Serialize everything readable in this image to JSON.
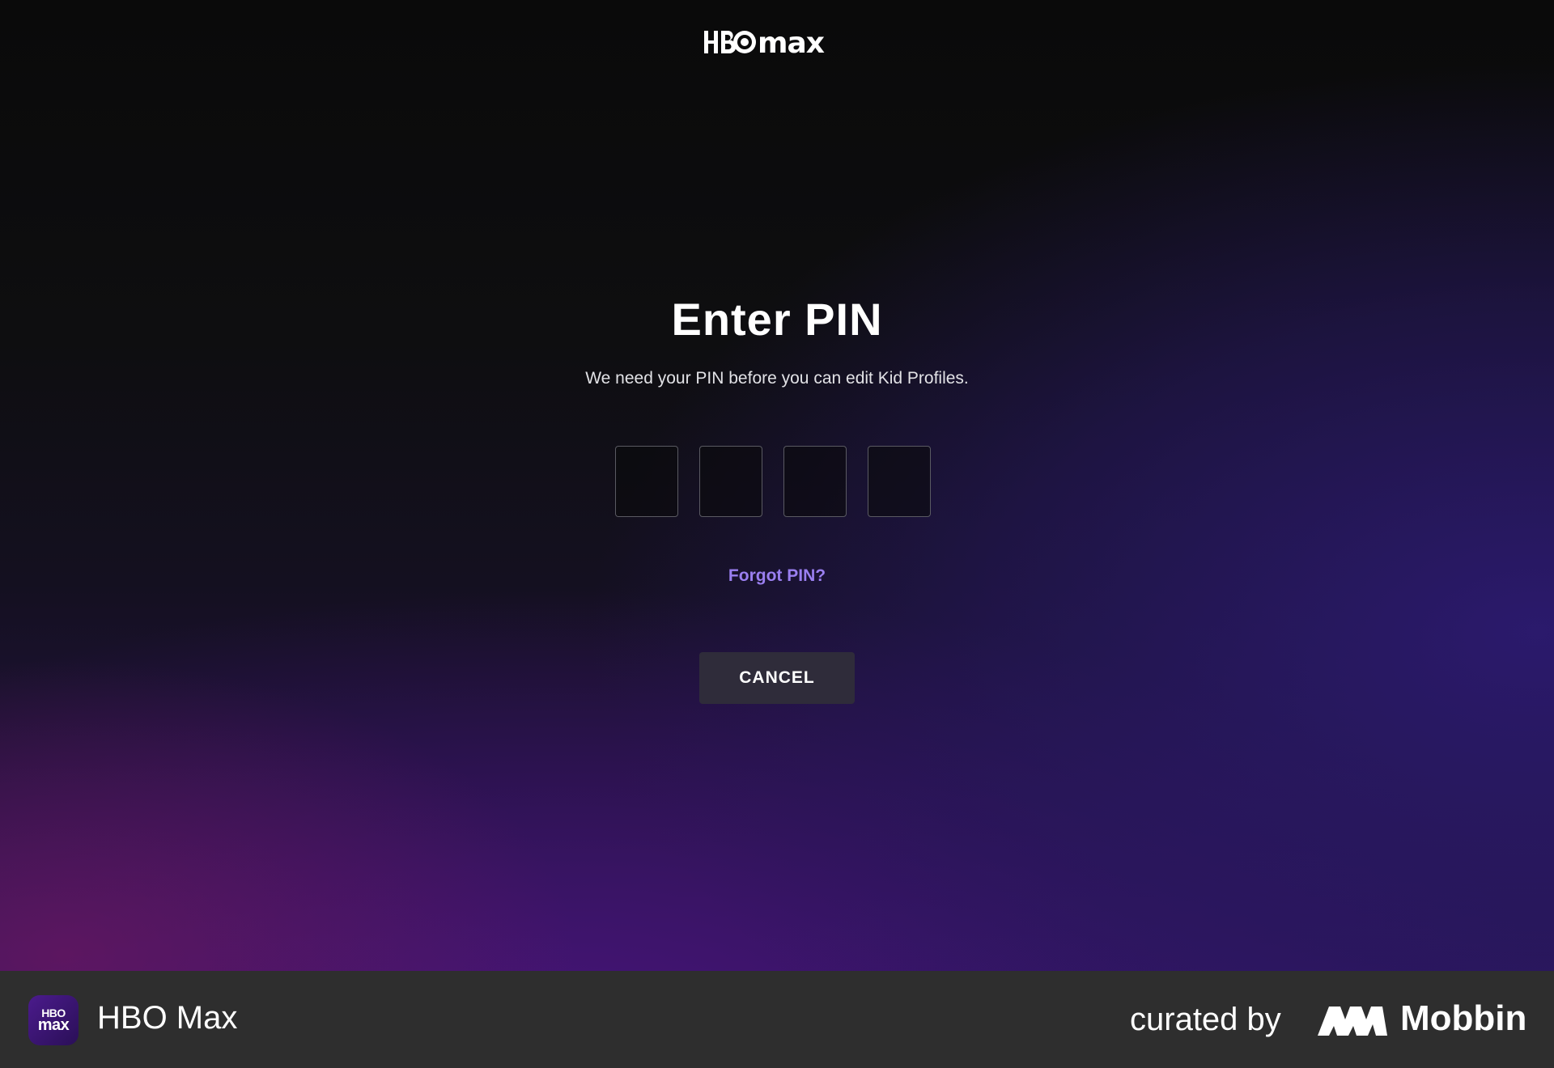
{
  "header": {
    "logo_icon": "hbo-max-logo",
    "logo_text": "HBOmax"
  },
  "main": {
    "title": "Enter PIN",
    "subtitle": "We need your PIN before you can edit Kid Profiles.",
    "pin_fields": [
      {
        "value": ""
      },
      {
        "value": ""
      },
      {
        "value": ""
      },
      {
        "value": ""
      }
    ],
    "forgot_link": "Forgot PIN?",
    "cancel_label": "CANCEL",
    "colors": {
      "accent": "#9a7ff0",
      "button_bg": "#2f2c3a"
    }
  },
  "footer": {
    "app_icon": "hbo-max-app-icon",
    "app_icon_text_top": "HBO",
    "app_icon_text_bottom": "max",
    "app_name": "HBO Max",
    "curated_by": "curated by",
    "mobbin_icon": "mobbin-logo",
    "mobbin_label": "Mobbin"
  }
}
